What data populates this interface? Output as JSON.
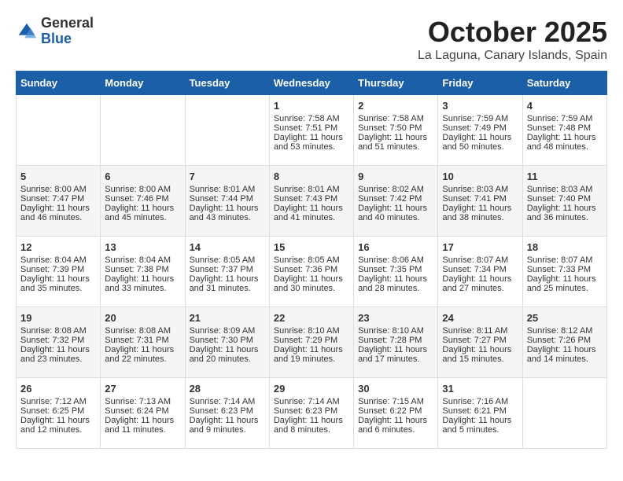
{
  "logo": {
    "general": "General",
    "blue": "Blue"
  },
  "title": "October 2025",
  "location": "La Laguna, Canary Islands, Spain",
  "headers": [
    "Sunday",
    "Monday",
    "Tuesday",
    "Wednesday",
    "Thursday",
    "Friday",
    "Saturday"
  ],
  "weeks": [
    [
      {
        "day": "",
        "sunrise": "",
        "sunset": "",
        "daylight": ""
      },
      {
        "day": "",
        "sunrise": "",
        "sunset": "",
        "daylight": ""
      },
      {
        "day": "",
        "sunrise": "",
        "sunset": "",
        "daylight": ""
      },
      {
        "day": "1",
        "sunrise": "Sunrise: 7:58 AM",
        "sunset": "Sunset: 7:51 PM",
        "daylight": "Daylight: 11 hours and 53 minutes."
      },
      {
        "day": "2",
        "sunrise": "Sunrise: 7:58 AM",
        "sunset": "Sunset: 7:50 PM",
        "daylight": "Daylight: 11 hours and 51 minutes."
      },
      {
        "day": "3",
        "sunrise": "Sunrise: 7:59 AM",
        "sunset": "Sunset: 7:49 PM",
        "daylight": "Daylight: 11 hours and 50 minutes."
      },
      {
        "day": "4",
        "sunrise": "Sunrise: 7:59 AM",
        "sunset": "Sunset: 7:48 PM",
        "daylight": "Daylight: 11 hours and 48 minutes."
      }
    ],
    [
      {
        "day": "5",
        "sunrise": "Sunrise: 8:00 AM",
        "sunset": "Sunset: 7:47 PM",
        "daylight": "Daylight: 11 hours and 46 minutes."
      },
      {
        "day": "6",
        "sunrise": "Sunrise: 8:00 AM",
        "sunset": "Sunset: 7:46 PM",
        "daylight": "Daylight: 11 hours and 45 minutes."
      },
      {
        "day": "7",
        "sunrise": "Sunrise: 8:01 AM",
        "sunset": "Sunset: 7:44 PM",
        "daylight": "Daylight: 11 hours and 43 minutes."
      },
      {
        "day": "8",
        "sunrise": "Sunrise: 8:01 AM",
        "sunset": "Sunset: 7:43 PM",
        "daylight": "Daylight: 11 hours and 41 minutes."
      },
      {
        "day": "9",
        "sunrise": "Sunrise: 8:02 AM",
        "sunset": "Sunset: 7:42 PM",
        "daylight": "Daylight: 11 hours and 40 minutes."
      },
      {
        "day": "10",
        "sunrise": "Sunrise: 8:03 AM",
        "sunset": "Sunset: 7:41 PM",
        "daylight": "Daylight: 11 hours and 38 minutes."
      },
      {
        "day": "11",
        "sunrise": "Sunrise: 8:03 AM",
        "sunset": "Sunset: 7:40 PM",
        "daylight": "Daylight: 11 hours and 36 minutes."
      }
    ],
    [
      {
        "day": "12",
        "sunrise": "Sunrise: 8:04 AM",
        "sunset": "Sunset: 7:39 PM",
        "daylight": "Daylight: 11 hours and 35 minutes."
      },
      {
        "day": "13",
        "sunrise": "Sunrise: 8:04 AM",
        "sunset": "Sunset: 7:38 PM",
        "daylight": "Daylight: 11 hours and 33 minutes."
      },
      {
        "day": "14",
        "sunrise": "Sunrise: 8:05 AM",
        "sunset": "Sunset: 7:37 PM",
        "daylight": "Daylight: 11 hours and 31 minutes."
      },
      {
        "day": "15",
        "sunrise": "Sunrise: 8:05 AM",
        "sunset": "Sunset: 7:36 PM",
        "daylight": "Daylight: 11 hours and 30 minutes."
      },
      {
        "day": "16",
        "sunrise": "Sunrise: 8:06 AM",
        "sunset": "Sunset: 7:35 PM",
        "daylight": "Daylight: 11 hours and 28 minutes."
      },
      {
        "day": "17",
        "sunrise": "Sunrise: 8:07 AM",
        "sunset": "Sunset: 7:34 PM",
        "daylight": "Daylight: 11 hours and 27 minutes."
      },
      {
        "day": "18",
        "sunrise": "Sunrise: 8:07 AM",
        "sunset": "Sunset: 7:33 PM",
        "daylight": "Daylight: 11 hours and 25 minutes."
      }
    ],
    [
      {
        "day": "19",
        "sunrise": "Sunrise: 8:08 AM",
        "sunset": "Sunset: 7:32 PM",
        "daylight": "Daylight: 11 hours and 23 minutes."
      },
      {
        "day": "20",
        "sunrise": "Sunrise: 8:08 AM",
        "sunset": "Sunset: 7:31 PM",
        "daylight": "Daylight: 11 hours and 22 minutes."
      },
      {
        "day": "21",
        "sunrise": "Sunrise: 8:09 AM",
        "sunset": "Sunset: 7:30 PM",
        "daylight": "Daylight: 11 hours and 20 minutes."
      },
      {
        "day": "22",
        "sunrise": "Sunrise: 8:10 AM",
        "sunset": "Sunset: 7:29 PM",
        "daylight": "Daylight: 11 hours and 19 minutes."
      },
      {
        "day": "23",
        "sunrise": "Sunrise: 8:10 AM",
        "sunset": "Sunset: 7:28 PM",
        "daylight": "Daylight: 11 hours and 17 minutes."
      },
      {
        "day": "24",
        "sunrise": "Sunrise: 8:11 AM",
        "sunset": "Sunset: 7:27 PM",
        "daylight": "Daylight: 11 hours and 15 minutes."
      },
      {
        "day": "25",
        "sunrise": "Sunrise: 8:12 AM",
        "sunset": "Sunset: 7:26 PM",
        "daylight": "Daylight: 11 hours and 14 minutes."
      }
    ],
    [
      {
        "day": "26",
        "sunrise": "Sunrise: 7:12 AM",
        "sunset": "Sunset: 6:25 PM",
        "daylight": "Daylight: 11 hours and 12 minutes."
      },
      {
        "day": "27",
        "sunrise": "Sunrise: 7:13 AM",
        "sunset": "Sunset: 6:24 PM",
        "daylight": "Daylight: 11 hours and 11 minutes."
      },
      {
        "day": "28",
        "sunrise": "Sunrise: 7:14 AM",
        "sunset": "Sunset: 6:23 PM",
        "daylight": "Daylight: 11 hours and 9 minutes."
      },
      {
        "day": "29",
        "sunrise": "Sunrise: 7:14 AM",
        "sunset": "Sunset: 6:23 PM",
        "daylight": "Daylight: 11 hours and 8 minutes."
      },
      {
        "day": "30",
        "sunrise": "Sunrise: 7:15 AM",
        "sunset": "Sunset: 6:22 PM",
        "daylight": "Daylight: 11 hours and 6 minutes."
      },
      {
        "day": "31",
        "sunrise": "Sunrise: 7:16 AM",
        "sunset": "Sunset: 6:21 PM",
        "daylight": "Daylight: 11 hours and 5 minutes."
      },
      {
        "day": "",
        "sunrise": "",
        "sunset": "",
        "daylight": ""
      }
    ]
  ]
}
